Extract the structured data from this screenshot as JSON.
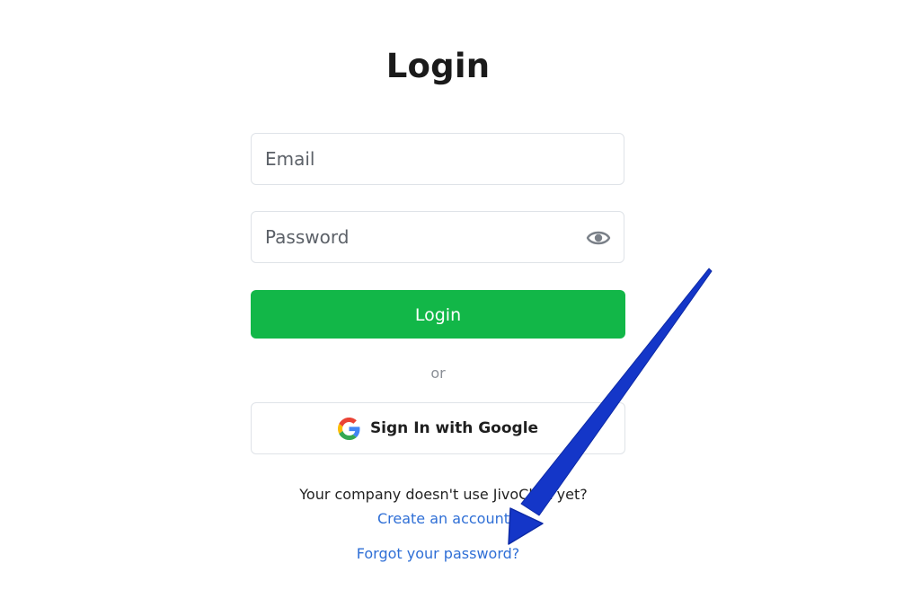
{
  "page": {
    "title": "Login"
  },
  "form": {
    "email_placeholder": "Email",
    "password_placeholder": "Password",
    "login_label": "Login",
    "divider_text": "or",
    "google_label": "Sign In with Google"
  },
  "footer": {
    "company_text": "Your company doesn't use JivoChat yet?",
    "create_account_label": "Create an account",
    "forgot_password_label": "Forgot your password?"
  },
  "icons": {
    "password_toggle": "eye-icon",
    "google": "google-icon",
    "annotation": "arrow-annotation"
  },
  "colors": {
    "primary": "#12b748",
    "link": "#2f6fd6",
    "annotation_arrow": "#1436c8"
  }
}
